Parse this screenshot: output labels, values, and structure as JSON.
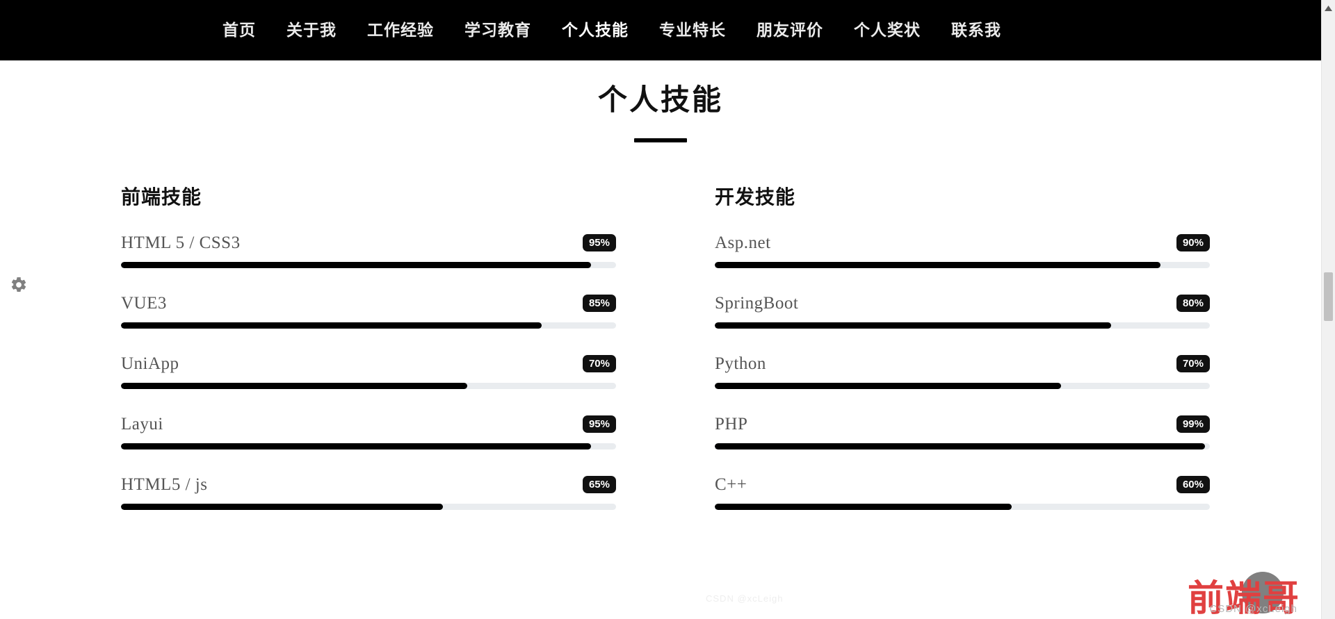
{
  "nav": {
    "items": [
      {
        "label": "首页",
        "active": false
      },
      {
        "label": "关于我",
        "active": false
      },
      {
        "label": "工作经验",
        "active": false
      },
      {
        "label": "学习教育",
        "active": false
      },
      {
        "label": "个人技能",
        "active": true
      },
      {
        "label": "专业特长",
        "active": false
      },
      {
        "label": "朋友评价",
        "active": false
      },
      {
        "label": "个人奖状",
        "active": false
      },
      {
        "label": "联系我",
        "active": false
      }
    ]
  },
  "section": {
    "title": "个人技能"
  },
  "chart_data": {
    "type": "bar",
    "title": "个人技能",
    "xlabel": "",
    "ylabel": "",
    "ylim": [
      0,
      100
    ],
    "groups": [
      {
        "name": "前端技能",
        "categories": [
          "HTML 5 / CSS3",
          "VUE3",
          "UniApp",
          "Layui",
          "HTML5 / js"
        ],
        "values": [
          95,
          85,
          70,
          95,
          65
        ],
        "labels": [
          "95%",
          "85%",
          "70%",
          "95%",
          "65%"
        ]
      },
      {
        "name": "开发技能",
        "categories": [
          "Asp.net",
          "SpringBoot",
          "Python",
          "PHP",
          "C++"
        ],
        "values": [
          90,
          80,
          70,
          99,
          60
        ],
        "labels": [
          "90%",
          "80%",
          "70%",
          "99%",
          "60%"
        ]
      }
    ]
  },
  "skills": {
    "columns": [
      {
        "title": "前端技能",
        "rows": [
          {
            "name": "HTML 5 / CSS3",
            "percent": 95,
            "label": "95%"
          },
          {
            "name": "VUE3",
            "percent": 85,
            "label": "85%"
          },
          {
            "name": "UniApp",
            "percent": 70,
            "label": "70%"
          },
          {
            "name": "Layui",
            "percent": 95,
            "label": "95%"
          },
          {
            "name": "HTML5 / js",
            "percent": 65,
            "label": "65%"
          }
        ]
      },
      {
        "title": "开发技能",
        "rows": [
          {
            "name": "Asp.net",
            "percent": 90,
            "label": "90%"
          },
          {
            "name": "SpringBoot",
            "percent": 80,
            "label": "80%"
          },
          {
            "name": "Python",
            "percent": 70,
            "label": "70%"
          },
          {
            "name": "PHP",
            "percent": 99,
            "label": "99%"
          },
          {
            "name": "C++",
            "percent": 60,
            "label": "60%"
          }
        ]
      }
    ]
  },
  "widgets": {
    "gear_icon": "gear-icon",
    "back_to_top_icon": "arrow-up-icon",
    "scroll_up_icon": "triangle-up-icon"
  },
  "watermarks": {
    "brand": "前端哥",
    "csdn": "CSDN @xcLeigh",
    "csdn_secondary": "CSDN @xcLeigh"
  },
  "colors": {
    "nav_background": "#000000",
    "nav_text": "#ffffff",
    "badge_background": "#111111",
    "badge_text": "#ffffff",
    "bar_fill": "#000000",
    "bar_track": "#e9ecef",
    "watermark_brand": "#e04040",
    "back_to_top": "#808080",
    "gear": "#808080"
  }
}
